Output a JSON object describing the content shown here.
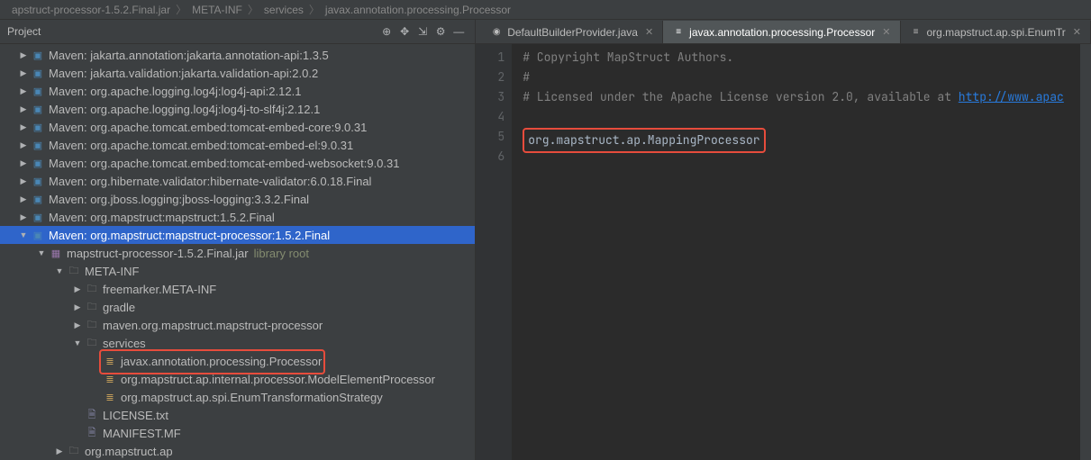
{
  "breadcrumb": {
    "jar": "apstruct-processor-1.5.2.Final.jar",
    "p1": "META-INF",
    "p2": "services",
    "p3": "javax.annotation.processing.Processor"
  },
  "sidebar": {
    "title": "Project"
  },
  "tree": [
    {
      "ind": 20,
      "tw": "r",
      "ic": "lib",
      "txt": "Maven: jakarta.annotation:jakarta.annotation-api:1.3.5"
    },
    {
      "ind": 20,
      "tw": "r",
      "ic": "lib",
      "txt": "Maven: jakarta.validation:jakarta.validation-api:2.0.2"
    },
    {
      "ind": 20,
      "tw": "r",
      "ic": "lib",
      "txt": "Maven: org.apache.logging.log4j:log4j-api:2.12.1"
    },
    {
      "ind": 20,
      "tw": "r",
      "ic": "lib",
      "txt": "Maven: org.apache.logging.log4j:log4j-to-slf4j:2.12.1"
    },
    {
      "ind": 20,
      "tw": "r",
      "ic": "lib",
      "txt": "Maven: org.apache.tomcat.embed:tomcat-embed-core:9.0.31"
    },
    {
      "ind": 20,
      "tw": "r",
      "ic": "lib",
      "txt": "Maven: org.apache.tomcat.embed:tomcat-embed-el:9.0.31"
    },
    {
      "ind": 20,
      "tw": "r",
      "ic": "lib",
      "txt": "Maven: org.apache.tomcat.embed:tomcat-embed-websocket:9.0.31"
    },
    {
      "ind": 20,
      "tw": "r",
      "ic": "lib",
      "txt": "Maven: org.hibernate.validator:hibernate-validator:6.0.18.Final"
    },
    {
      "ind": 20,
      "tw": "r",
      "ic": "lib",
      "txt": "Maven: org.jboss.logging:jboss-logging:3.3.2.Final"
    },
    {
      "ind": 20,
      "tw": "r",
      "ic": "lib",
      "txt": "Maven: org.mapstruct:mapstruct:1.5.2.Final"
    },
    {
      "ind": 20,
      "tw": "d",
      "ic": "lib",
      "txt": "Maven: org.mapstruct:mapstruct-processor:1.5.2.Final",
      "sel": true
    },
    {
      "ind": 40,
      "tw": "d",
      "ic": "jar",
      "txt": "mapstruct-processor-1.5.2.Final.jar",
      "hint": "library root"
    },
    {
      "ind": 60,
      "tw": "d",
      "ic": "dir",
      "txt": "META-INF"
    },
    {
      "ind": 80,
      "tw": "r",
      "ic": "dir",
      "txt": "freemarker.META-INF"
    },
    {
      "ind": 80,
      "tw": "r",
      "ic": "dir",
      "txt": "gradle"
    },
    {
      "ind": 80,
      "tw": "r",
      "ic": "dir",
      "txt": "maven.org.mapstruct.mapstruct-processor"
    },
    {
      "ind": 80,
      "tw": "d",
      "ic": "dir",
      "txt": "services"
    },
    {
      "ind": 100,
      "tw": "",
      "ic": "cf",
      "txt": "javax.annotation.processing.Processor",
      "mark": true
    },
    {
      "ind": 100,
      "tw": "",
      "ic": "cf",
      "txt": "org.mapstruct.ap.internal.processor.ModelElementProcessor"
    },
    {
      "ind": 100,
      "tw": "",
      "ic": "cf",
      "txt": "org.mapstruct.ap.spi.EnumTransformationStrategy"
    },
    {
      "ind": 80,
      "tw": "",
      "ic": "fi",
      "txt": "LICENSE.txt"
    },
    {
      "ind": 80,
      "tw": "",
      "ic": "fi",
      "txt": "MANIFEST.MF"
    },
    {
      "ind": 60,
      "tw": "r",
      "ic": "dir",
      "txt": "org.mapstruct.ap"
    }
  ],
  "tabs": [
    {
      "label": "DefaultBuilderProvider.java",
      "active": false,
      "ic": "◉"
    },
    {
      "label": "javax.annotation.processing.Processor",
      "active": true,
      "ic": "≡"
    },
    {
      "label": "org.mapstruct.ap.spi.EnumTr",
      "active": false,
      "ic": "≡"
    }
  ],
  "code": {
    "lines": [
      "1",
      "2",
      "3",
      "4",
      "5",
      "6"
    ],
    "l1a": "# Copyright MapStruct Authors.",
    "l2a": "#",
    "l3a": "# Licensed under the Apache License version 2.0, available at ",
    "l3b": "http://www.apac",
    "l5": "org.mapstruct.ap.MappingProcessor"
  }
}
